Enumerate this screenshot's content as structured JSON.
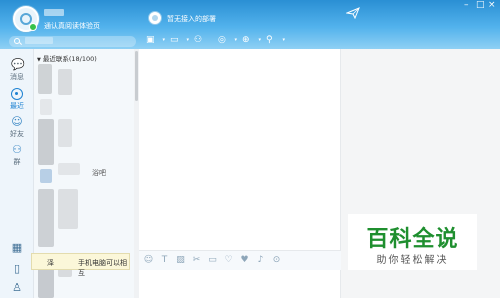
{
  "header": {
    "signature": "通认真阅读体验页",
    "chat_title": "暂无接入的部署",
    "window_controls": [
      "–",
      "□",
      "×"
    ],
    "toolbar_icons": [
      "screenshot-icon",
      "video-call-icon",
      "add-user-icon",
      "remote-icon",
      "apps-icon",
      "more-icon"
    ]
  },
  "search": {
    "icon": "search-icon"
  },
  "sidebar": {
    "items": [
      {
        "label": "消息",
        "icon": "chat-bubble-icon"
      },
      {
        "label": "最近",
        "icon": "recent-icon"
      },
      {
        "label": "好友",
        "icon": "friend-icon"
      },
      {
        "label": "群",
        "icon": "group-icon"
      }
    ],
    "bottom_icons": [
      "apps-grid-icon",
      "phone-icon",
      "contacts-icon"
    ]
  },
  "contacts": {
    "group_header": "最近联系(18/100)",
    "partial_label": "浴吧"
  },
  "tooltip": {
    "text_a": "泽",
    "text_b": "手机电脑可以相互"
  },
  "input_toolbar": {
    "icons": [
      "emoji-icon",
      "text-format-icon",
      "image-icon",
      "cut-icon",
      "folder-icon",
      "gift-icon",
      "heart-icon",
      "mic-icon",
      "history-icon"
    ]
  },
  "watermark": {
    "title": "百科全说",
    "subtitle": "助你轻松解决"
  },
  "colors": {
    "header_top": "#2a8fd4",
    "header_bottom": "#8fd0f4",
    "accent": "#1e82d2",
    "watermark_green": "#1f8f2f"
  }
}
